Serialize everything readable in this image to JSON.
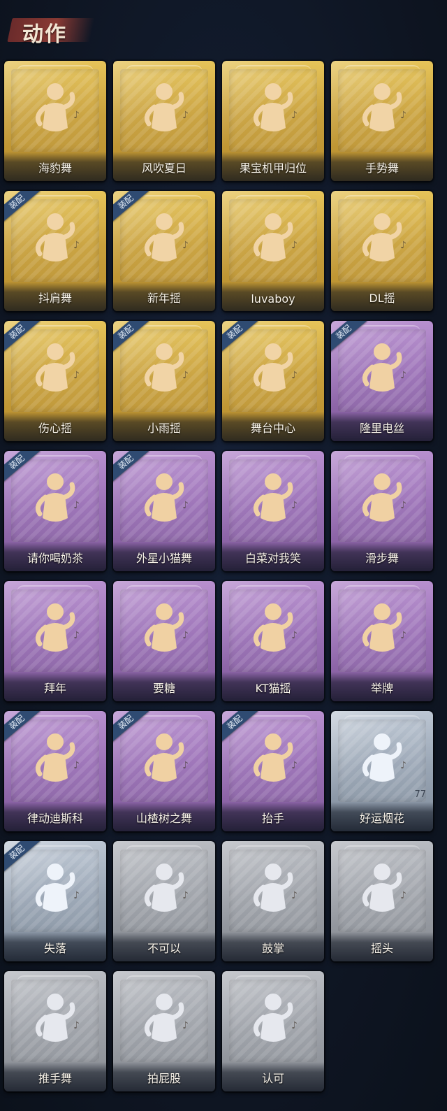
{
  "header": {
    "title": "动作"
  },
  "colors": {
    "background": "#0f1725",
    "gold": "#d3ab45",
    "purple": "#9a70b6",
    "silver": "#9aa6b5",
    "gray": "#9ea2a9",
    "equip_badge": "#2f4b72"
  },
  "actions": [
    {
      "name": "海豹舞",
      "rarity": "gold",
      "equipped": false,
      "icon": "dance-pose-icon"
    },
    {
      "name": "风吹夏日",
      "rarity": "gold",
      "equipped": false,
      "icon": "music-pose-icon"
    },
    {
      "name": "果宝机甲归位",
      "rarity": "gold",
      "equipped": false,
      "icon": "robot-pose-icon"
    },
    {
      "name": "手势舞",
      "rarity": "gold",
      "equipped": false,
      "icon": "hand-gesture-icon"
    },
    {
      "name": "抖肩舞",
      "rarity": "gold",
      "equipped": true,
      "icon": "shoulder-shake-icon"
    },
    {
      "name": "新年摇",
      "rarity": "gold",
      "equipped": true,
      "icon": "new-year-shake-icon"
    },
    {
      "name": "luvaboy",
      "rarity": "gold",
      "equipped": false,
      "icon": "luvaboy-pose-icon"
    },
    {
      "name": "DL摇",
      "rarity": "gold",
      "equipped": false,
      "icon": "arm-raise-icon"
    },
    {
      "name": "伤心摇",
      "rarity": "gold",
      "equipped": true,
      "icon": "heart-hands-icon"
    },
    {
      "name": "小雨摇",
      "rarity": "gold",
      "equipped": true,
      "icon": "rain-dance-icon"
    },
    {
      "name": "舞台中心",
      "rarity": "gold",
      "equipped": true,
      "icon": "stage-center-icon"
    },
    {
      "name": "隆里电丝",
      "rarity": "purple",
      "equipped": true,
      "icon": "pointing-dance-icon"
    },
    {
      "name": "请你喝奶茶",
      "rarity": "purple",
      "equipped": true,
      "icon": "scroll-sign-icon"
    },
    {
      "name": "外星小猫舞",
      "rarity": "purple",
      "equipped": true,
      "icon": "alien-cat-dance-icon"
    },
    {
      "name": "白菜对我笑",
      "rarity": "purple",
      "equipped": false,
      "icon": "cabbage-dance-icon"
    },
    {
      "name": "滑步舞",
      "rarity": "purple",
      "equipped": false,
      "icon": "slide-step-icon"
    },
    {
      "name": "拜年",
      "rarity": "purple",
      "equipped": false,
      "icon": "greeting-bow-icon"
    },
    {
      "name": "要糖",
      "rarity": "purple",
      "equipped": false,
      "icon": "ask-candy-icon"
    },
    {
      "name": "KT猫摇",
      "rarity": "purple",
      "equipped": false,
      "icon": "kt-cat-shake-icon"
    },
    {
      "name": "举牌",
      "rarity": "purple",
      "equipped": false,
      "icon": "hold-sign-icon"
    },
    {
      "name": "律动迪斯科",
      "rarity": "purple",
      "equipped": true,
      "icon": "disco-icon"
    },
    {
      "name": "山楂树之舞",
      "rarity": "purple",
      "equipped": true,
      "icon": "hawthorn-dance-icon"
    },
    {
      "name": "抬手",
      "rarity": "purple",
      "equipped": true,
      "icon": "raise-hand-icon"
    },
    {
      "name": "好运烟花",
      "rarity": "silver",
      "equipped": false,
      "icon": "firework-icon",
      "count": "77"
    },
    {
      "name": "失落",
      "rarity": "silver",
      "equipped": true,
      "icon": "crawl-sad-icon"
    },
    {
      "name": "不可以",
      "rarity": "gray",
      "equipped": false,
      "icon": "finger-no-icon"
    },
    {
      "name": "鼓掌",
      "rarity": "gray",
      "equipped": false,
      "icon": "clap-icon"
    },
    {
      "name": "摇头",
      "rarity": "gray",
      "equipped": false,
      "icon": "head-shake-icon"
    },
    {
      "name": "推手舞",
      "rarity": "gray",
      "equipped": false,
      "icon": "push-hand-icon"
    },
    {
      "name": "拍屁股",
      "rarity": "gray",
      "equipped": false,
      "icon": "slap-butt-icon"
    },
    {
      "name": "认可",
      "rarity": "gray",
      "equipped": false,
      "icon": "thumbs-up-icon"
    }
  ],
  "equip_label": "装配"
}
